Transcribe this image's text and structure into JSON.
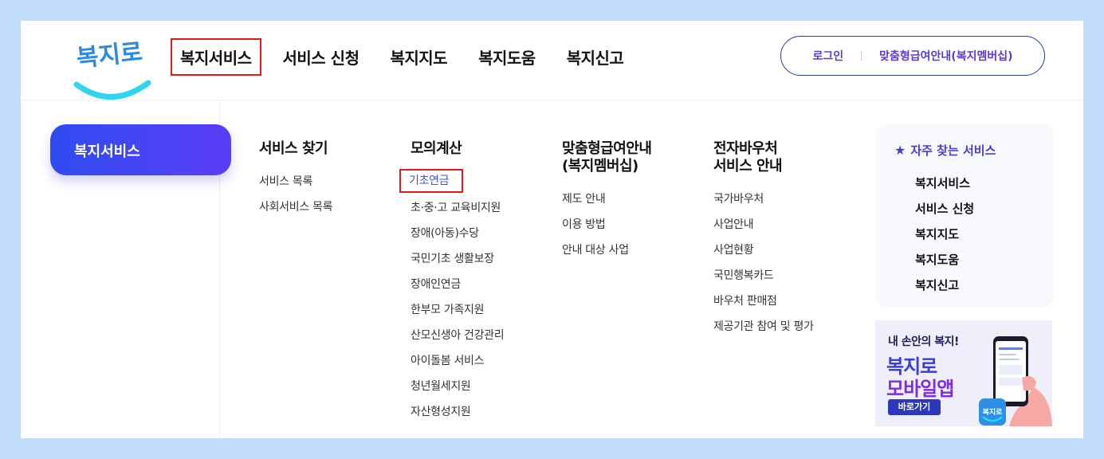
{
  "brand": {
    "logo_text": "복지로"
  },
  "gnb": [
    {
      "label": "복지서비스",
      "highlighted": true
    },
    {
      "label": "서비스 신청"
    },
    {
      "label": "복지지도"
    },
    {
      "label": "복지도움"
    },
    {
      "label": "복지신고"
    }
  ],
  "util": {
    "login": "로그인",
    "member_info": "맞춤형급여안내(복지멤버십)"
  },
  "mega": {
    "active_tab": "복지서비스",
    "columns": [
      {
        "title": "서비스 찾기",
        "items": [
          "서비스 목록",
          "사회서비스 목록"
        ]
      },
      {
        "title": "모의계산",
        "items": [
          "기초연금",
          "초·중·고 교육비지원",
          "장애(아동)수당",
          "국민기초 생활보장",
          "장애인연금",
          "한부모 가족지원",
          "산모신생아 건강관리",
          "아이돌봄 서비스",
          "청년월세지원",
          "자산형성지원"
        ]
      },
      {
        "title": "맞춤형급여안내\n(복지멤버십)",
        "items": [
          "제도 안내",
          "이용 방법",
          "안내 대상 사업"
        ]
      },
      {
        "title": "전자바우처\n서비스 안내",
        "items": [
          "국가바우처",
          "사업안내",
          "사업현황",
          "국민행복카드",
          "바우처 판매점",
          "제공기관 참여 및 평가"
        ]
      }
    ]
  },
  "favorites": {
    "title": "자주 찾는 서비스",
    "icon": "star-icon",
    "items": [
      "복지서비스",
      "서비스 신청",
      "복지지도",
      "복지도움",
      "복지신고"
    ]
  },
  "banner": {
    "subtitle": "내 손안의 복지!",
    "title_line1": "복지로",
    "title_line2": "모바일앱",
    "button": "바로가기",
    "app_icon_text": "복지로"
  },
  "colors": {
    "accent": "#4b3bd8",
    "tab_gradient_start": "#2f4cf1",
    "tab_gradient_end": "#5a3df5",
    "highlight_box": "#e21a1a",
    "logo_smile": "#2fd5ee",
    "logo_text": "#2b8be0"
  }
}
